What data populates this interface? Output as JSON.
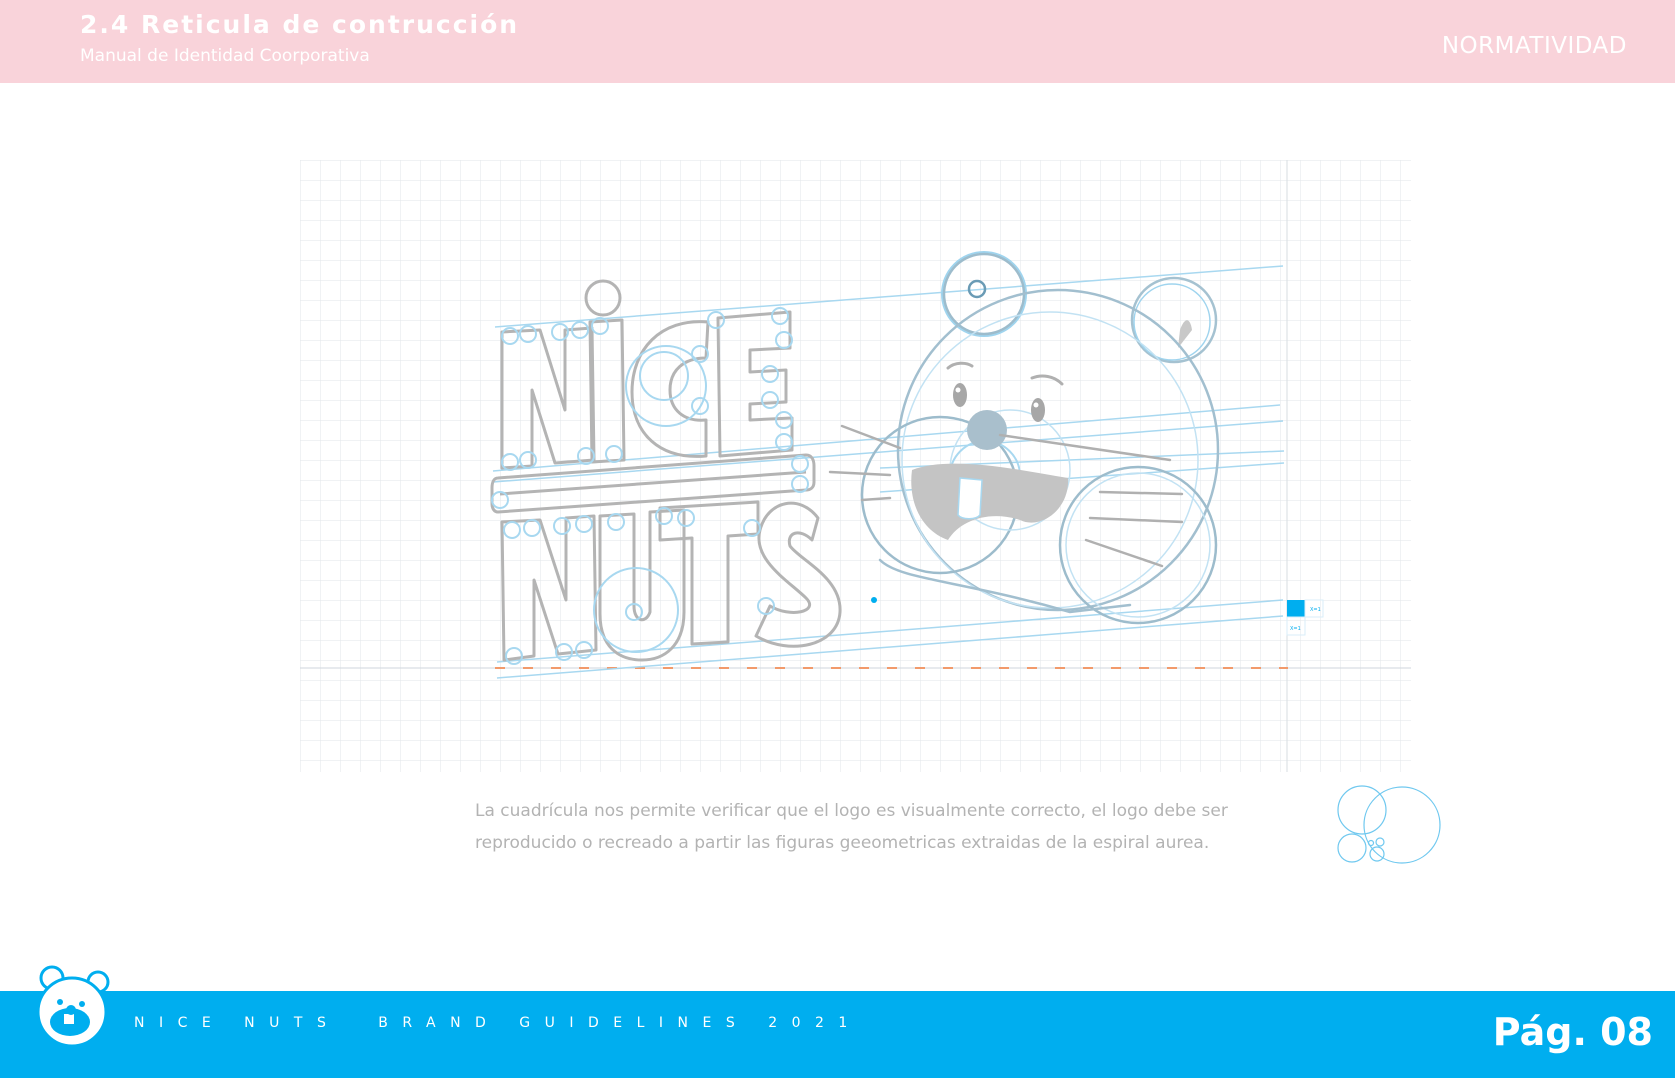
{
  "header": {
    "section_title": "2.4 Reticula de contrucción",
    "subtitle": "Manual de Identidad Coorporativa",
    "category": "NORMATIVIDAD"
  },
  "figure": {
    "logo_letters_top": "NiCE",
    "logo_letters_bottom": "NUTS",
    "unit_label_x": "X=1",
    "unit_label_y": "X=1"
  },
  "caption": {
    "line1": "La cuadrícula nos permite verificar que el logo es visualmente correcto, el logo debe ser",
    "line2": "reproducido o recreado a partir las figuras geeometricas extraidas  de la espiral aurea."
  },
  "footer": {
    "brand_text": "NICE NUTS  BRAND GUIDELINES 2021",
    "page_label": "Pág. 08"
  },
  "colors": {
    "header_bg": "#f9d3da",
    "footer_bg": "#00aeef",
    "construction_blue": "#9fd4ee",
    "outline_gray": "#b0b0b0",
    "baseline_orange": "#f29a6b"
  }
}
